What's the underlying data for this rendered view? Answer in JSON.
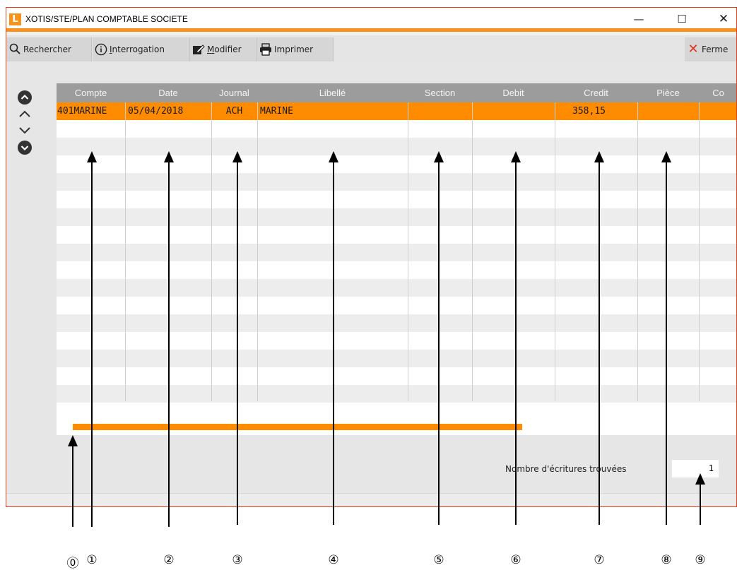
{
  "window": {
    "logo_letter": "L",
    "title": "XOTIS/STE/PLAN COMPTABLE SOCIETE",
    "minimize_glyph": "—",
    "maximize_glyph": "☐",
    "close_glyph": "✕"
  },
  "toolbar": {
    "rechercher": "Rechercher",
    "interrogation_first": "I",
    "interrogation_rest": "nterrogation",
    "modifier_first": "M",
    "modifier_rest": "odifier",
    "imprimer": "Imprimer",
    "fermer": "Ferme",
    "icons": {
      "rechercher": "search-icon",
      "interrogation": "info-icon",
      "modifier": "edit-icon",
      "imprimer": "printer-icon",
      "fermer": "close-icon"
    }
  },
  "grid": {
    "columns": [
      "Compte",
      "Date",
      "Journal",
      "Libellé",
      "Section",
      "Debit",
      "Credit",
      "Pièce",
      "Co"
    ],
    "rows": [
      {
        "compte": "401MARINE",
        "date": "05/04/2018",
        "journal": "ACH",
        "libelle": "MARINE",
        "section": "",
        "debit": "",
        "credit": "358,15",
        "piece": ""
      }
    ]
  },
  "footer": {
    "count_label": "Nombre d'écritures trouvées",
    "count_value": "1"
  },
  "annotations": [
    "⓪",
    "①",
    "②",
    "③",
    "④",
    "⑤",
    "⑥",
    "⑦",
    "⑧",
    "⑨"
  ],
  "colors": {
    "accent": "#ff8c00",
    "header": "#9c9c9c",
    "close_red": "#e0301e"
  }
}
